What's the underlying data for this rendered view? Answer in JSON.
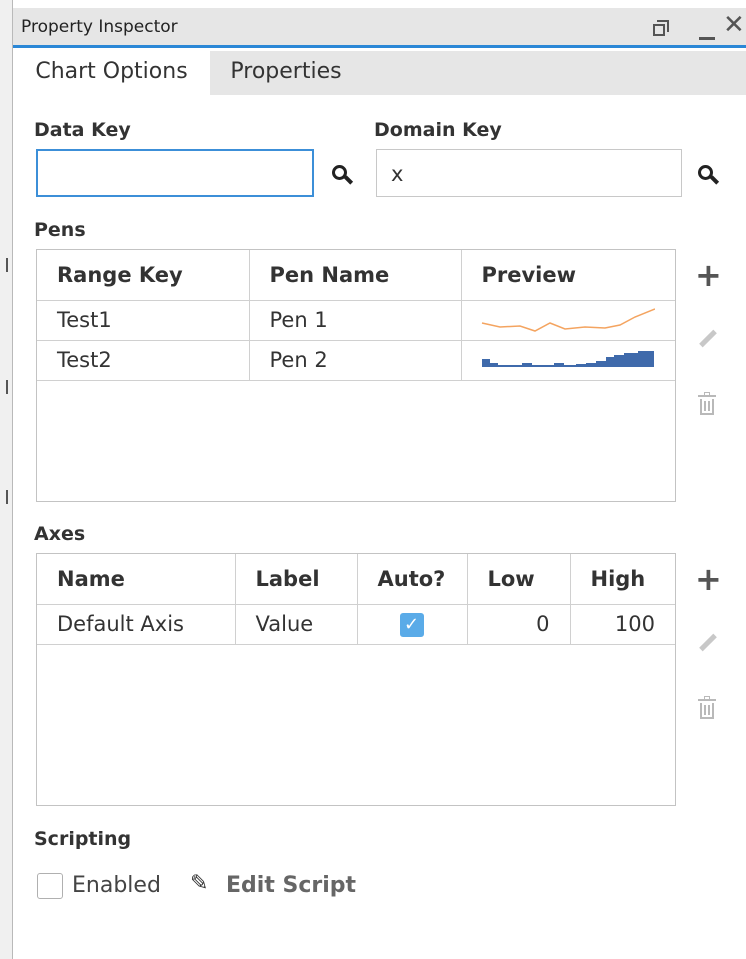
{
  "window": {
    "title": "Property Inspector"
  },
  "tabs": [
    {
      "label": "Chart Options"
    },
    {
      "label": "Properties"
    }
  ],
  "data_key": {
    "label": "Data Key",
    "value": ""
  },
  "domain_key": {
    "label": "Domain Key",
    "value": "x"
  },
  "pens": {
    "label": "Pens",
    "columns": [
      "Range Key",
      "Pen Name",
      "Preview"
    ],
    "rows": [
      {
        "range_key": "Test1",
        "pen_name": "Pen 1",
        "preview_color": "#f4a460",
        "preview_style": "line"
      },
      {
        "range_key": "Test2",
        "pen_name": "Pen 2",
        "preview_color": "#3f6aab",
        "preview_style": "bars"
      }
    ]
  },
  "axes": {
    "label": "Axes",
    "columns": [
      "Name",
      "Label",
      "Auto?",
      "Low",
      "High"
    ],
    "rows": [
      {
        "name": "Default Axis",
        "label": "Value",
        "auto": true,
        "low": "0",
        "high": "100"
      }
    ]
  },
  "scripting": {
    "label": "Scripting",
    "enabled_label": "Enabled",
    "enabled": false,
    "edit_script_label": "Edit Script"
  },
  "icons": {
    "add": "plus-icon",
    "edit": "pencil-icon",
    "delete": "trash-icon",
    "search": "search-icon"
  },
  "colors": {
    "accent": "#2b87d6",
    "checkbox": "#5aabe8",
    "pen1": "#f4a460",
    "pen2": "#3f6aab"
  }
}
